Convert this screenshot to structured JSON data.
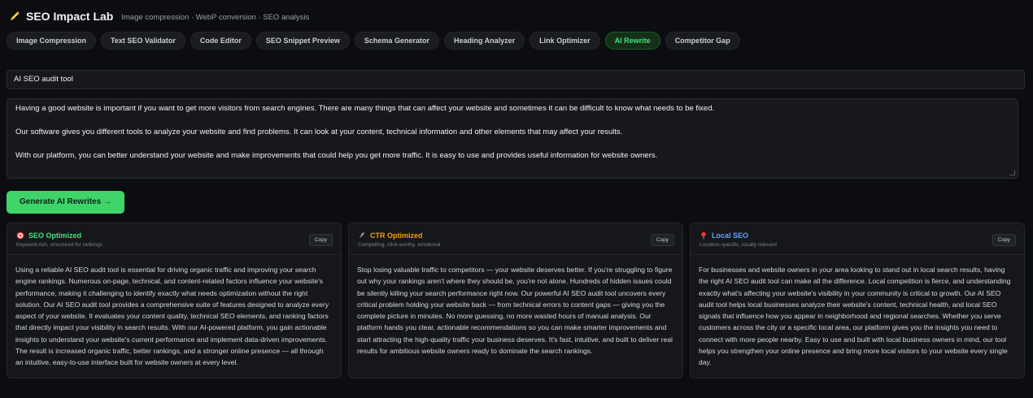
{
  "app": {
    "title": "SEO Impact Lab",
    "subtitle": "Image compression · WebP conversion · SEO analysis"
  },
  "tabs": [
    {
      "label": "Image Compression",
      "active": false
    },
    {
      "label": "Text SEO Validator",
      "active": false
    },
    {
      "label": "Code Editor",
      "active": false
    },
    {
      "label": "SEO Snippet Preview",
      "active": false
    },
    {
      "label": "Schema Generator",
      "active": false
    },
    {
      "label": "Heading Analyzer",
      "active": false
    },
    {
      "label": "Link Optimizer",
      "active": false
    },
    {
      "label": "AI Rewrite",
      "active": true
    },
    {
      "label": "Competitor Gap",
      "active": false
    }
  ],
  "keyword_input": {
    "value": "AI SEO audit tool"
  },
  "source_text": {
    "paragraphs": [
      "Having a good website is important if you want to get more visitors from search engines. There are many things that can affect your website and sometimes it can be difficult to know what needs to be fixed.",
      "Our software gives you different tools to analyze your website and find problems. It can look at your content, technical information and other elements that may affect your results.",
      "With our platform, you can better understand your website and make improvements that could help you get more traffic. It is easy to use and provides useful information for website owners."
    ]
  },
  "generate_button": {
    "label": "Generate AI Rewrites →"
  },
  "colors": {
    "accent": "#3fd46a",
    "seo_title": "#4ade80",
    "ctr_title": "#f59e0b",
    "local_title": "#60a5fa"
  },
  "cards": [
    {
      "icon": "target-icon",
      "title": "SEO Optimized",
      "desc": "Keyword-rich, structured for rankings",
      "copy": "Copy",
      "body": "Using a reliable AI SEO audit tool is essential for driving organic traffic and improving your search engine rankings. Numerous on-page, technical, and content-related factors influence your website's performance, making it challenging to identify exactly what needs optimization without the right solution. Our AI SEO audit tool provides a comprehensive suite of features designed to analyze every aspect of your website. It evaluates your content quality, technical SEO elements, and ranking factors that directly impact your visibility in search results. With our AI-powered platform, you gain actionable insights to understand your website's current performance and implement data-driven improvements. The result is increased organic traffic, better rankings, and a stronger online presence — all through an intuitive, easy-to-use interface built for website owners at every level."
    },
    {
      "icon": "rocket-icon",
      "title": "CTR Optimized",
      "desc": "Compelling, click-worthy, emotional",
      "copy": "Copy",
      "body": "Stop losing valuable traffic to competitors — your website deserves better. If you're struggling to figure out why your rankings aren't where they should be, you're not alone. Hundreds of hidden issues could be silently killing your search performance right now. Our powerful AI SEO audit tool uncovers every critical problem holding your website back — from technical errors to content gaps — giving you the complete picture in minutes. No more guessing, no more wasted hours of manual analysis. Our platform hands you clear, actionable recommendations so you can make smarter improvements and start attracting the high-quality traffic your business deserves. It's fast, intuitive, and built to deliver real results for ambitious website owners ready to dominate the search rankings."
    },
    {
      "icon": "pin-icon",
      "title": "Local SEO",
      "desc": "Location-specific, locally relevant",
      "copy": "Copy",
      "body": "For businesses and website owners in your area looking to stand out in local search results, having the right AI SEO audit tool can make all the difference. Local competition is fierce, and understanding exactly what's affecting your website's visibility in your community is critical to growth. Our AI SEO audit tool helps local businesses analyze their website's content, technical health, and local SEO signals that influence how you appear in neighborhood and regional searches. Whether you serve customers across the city or a specific local area, our platform gives you the insights you need to connect with more people nearby. Easy to use and built with local business owners in mind, our tool helps you strengthen your online presence and bring more local visitors to your website every single day."
    }
  ]
}
